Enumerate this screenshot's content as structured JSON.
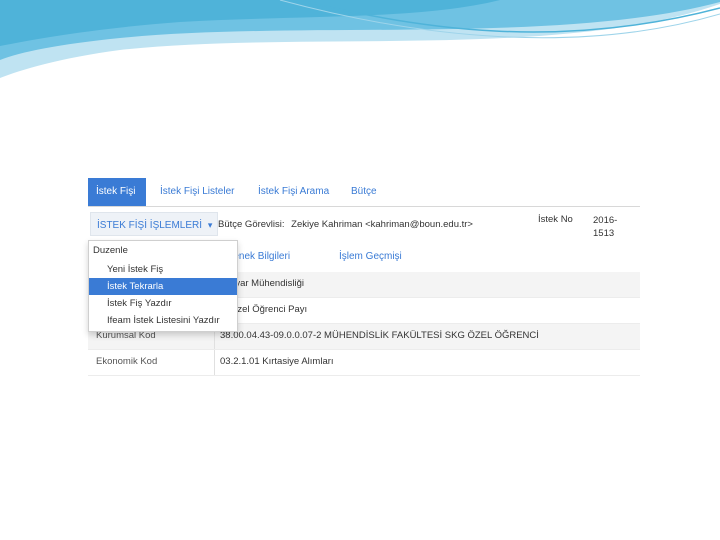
{
  "tabs": [
    {
      "label": "İstek Fişi",
      "active": true
    },
    {
      "label": "İstek Fişi Listeler",
      "active": false
    },
    {
      "label": "İstek Fişi Arama",
      "active": false
    },
    {
      "label": "Bütçe",
      "active": false
    }
  ],
  "ops": {
    "button_label": "İSTEK FİŞİ İŞLEMLERİ",
    "budget_label": "Bütçe Görevlisi:",
    "budget_value": "Zekiye Kahriman <kahriman@boun.edu.tr>",
    "request_no_label": "İstek No",
    "request_no_value": "2016-1513"
  },
  "menu": {
    "header": "Duzenle",
    "items": [
      {
        "label": "Yeni İstek Fiş",
        "selected": false
      },
      {
        "label": "İstek Tekrarla",
        "selected": true
      },
      {
        "label": "İstek Fiş Yazdır",
        "selected": false
      },
      {
        "label": "Ifeam İstek Listesini Yazdır",
        "selected": false
      }
    ]
  },
  "subtabs": [
    "Ödenek Bilgileri",
    "İşlem Geçmişi"
  ],
  "rows": [
    {
      "label": "",
      "value": "ğsayar Mühendisliği"
    },
    {
      "label": "",
      "value": "G Özel Öğrenci Payı"
    },
    {
      "label": "Kurumsal Kod",
      "value": "38.00.04.43-09.0.0.07-2 MÜHENDİSLİK FAKÜLTESİ SKG ÖZEL ÖĞRENCİ"
    },
    {
      "label": "Ekonomik Kod",
      "value": "03.2.1.01 Kırtasiye Alımları"
    }
  ],
  "colors": {
    "accent": "#3a7bd5",
    "swoosh": "#4fb3d9"
  }
}
